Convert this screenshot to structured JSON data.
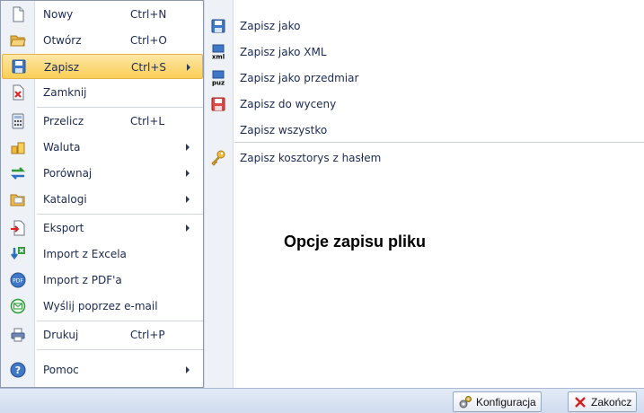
{
  "file_menu": {
    "items": [
      {
        "label": "Nowy",
        "shortcut": "Ctrl+N",
        "icon": "new-file-icon"
      },
      {
        "label": "Otwórz",
        "shortcut": "Ctrl+O",
        "icon": "open-folder-icon"
      },
      {
        "label": "Zapisz",
        "shortcut": "Ctrl+S",
        "icon": "save-icon",
        "selected": true,
        "has_submenu": true
      },
      {
        "label": "Zamknij",
        "shortcut": "",
        "icon": "close-document-icon"
      },
      {
        "label": "Przelicz",
        "shortcut": "Ctrl+L",
        "icon": "calculator-icon"
      },
      {
        "label": "Waluta",
        "shortcut": "",
        "icon": "coins-icon",
        "has_submenu": true
      },
      {
        "label": "Porównaj",
        "shortcut": "",
        "icon": "compare-arrows-icon",
        "has_submenu": true
      },
      {
        "label": "Katalogi",
        "shortcut": "",
        "icon": "catalog-folder-icon",
        "has_submenu": true
      },
      {
        "label": "Eksport",
        "shortcut": "",
        "icon": "export-icon",
        "has_submenu": true
      },
      {
        "label": "Import z Excela",
        "shortcut": "",
        "icon": "import-excel-icon"
      },
      {
        "label": "Import z PDF'a",
        "shortcut": "",
        "icon": "import-pdf-icon"
      },
      {
        "label": "Wyślij poprzez e-mail",
        "shortcut": "",
        "icon": "email-icon"
      },
      {
        "label": "Drukuj",
        "shortcut": "Ctrl+P",
        "icon": "printer-icon"
      },
      {
        "label": "Pomoc",
        "shortcut": "",
        "icon": "help-icon",
        "has_submenu": true
      }
    ]
  },
  "save_submenu": {
    "items": [
      {
        "label": "Zapisz jako",
        "icon": "save-as-icon"
      },
      {
        "label": "Zapisz jako XML",
        "icon": "xml-icon"
      },
      {
        "label": "Zapisz jako przedmiar",
        "icon": "puz-icon"
      },
      {
        "label": "Zapisz do wyceny",
        "icon": "save-red-icon"
      },
      {
        "label": "Zapisz wszystko",
        "icon": ""
      },
      {
        "label": "Zapisz kosztorys z hasłem",
        "icon": "key-icon"
      }
    ]
  },
  "description": {
    "title": "Opcje zapisu pliku"
  },
  "statusbar": {
    "config_label": "Konfiguracja",
    "exit_label": "Zakończ"
  },
  "colors": {
    "selection": "#fbcf55",
    "text": "#1b2a52",
    "gutter": "#eef1f5"
  }
}
